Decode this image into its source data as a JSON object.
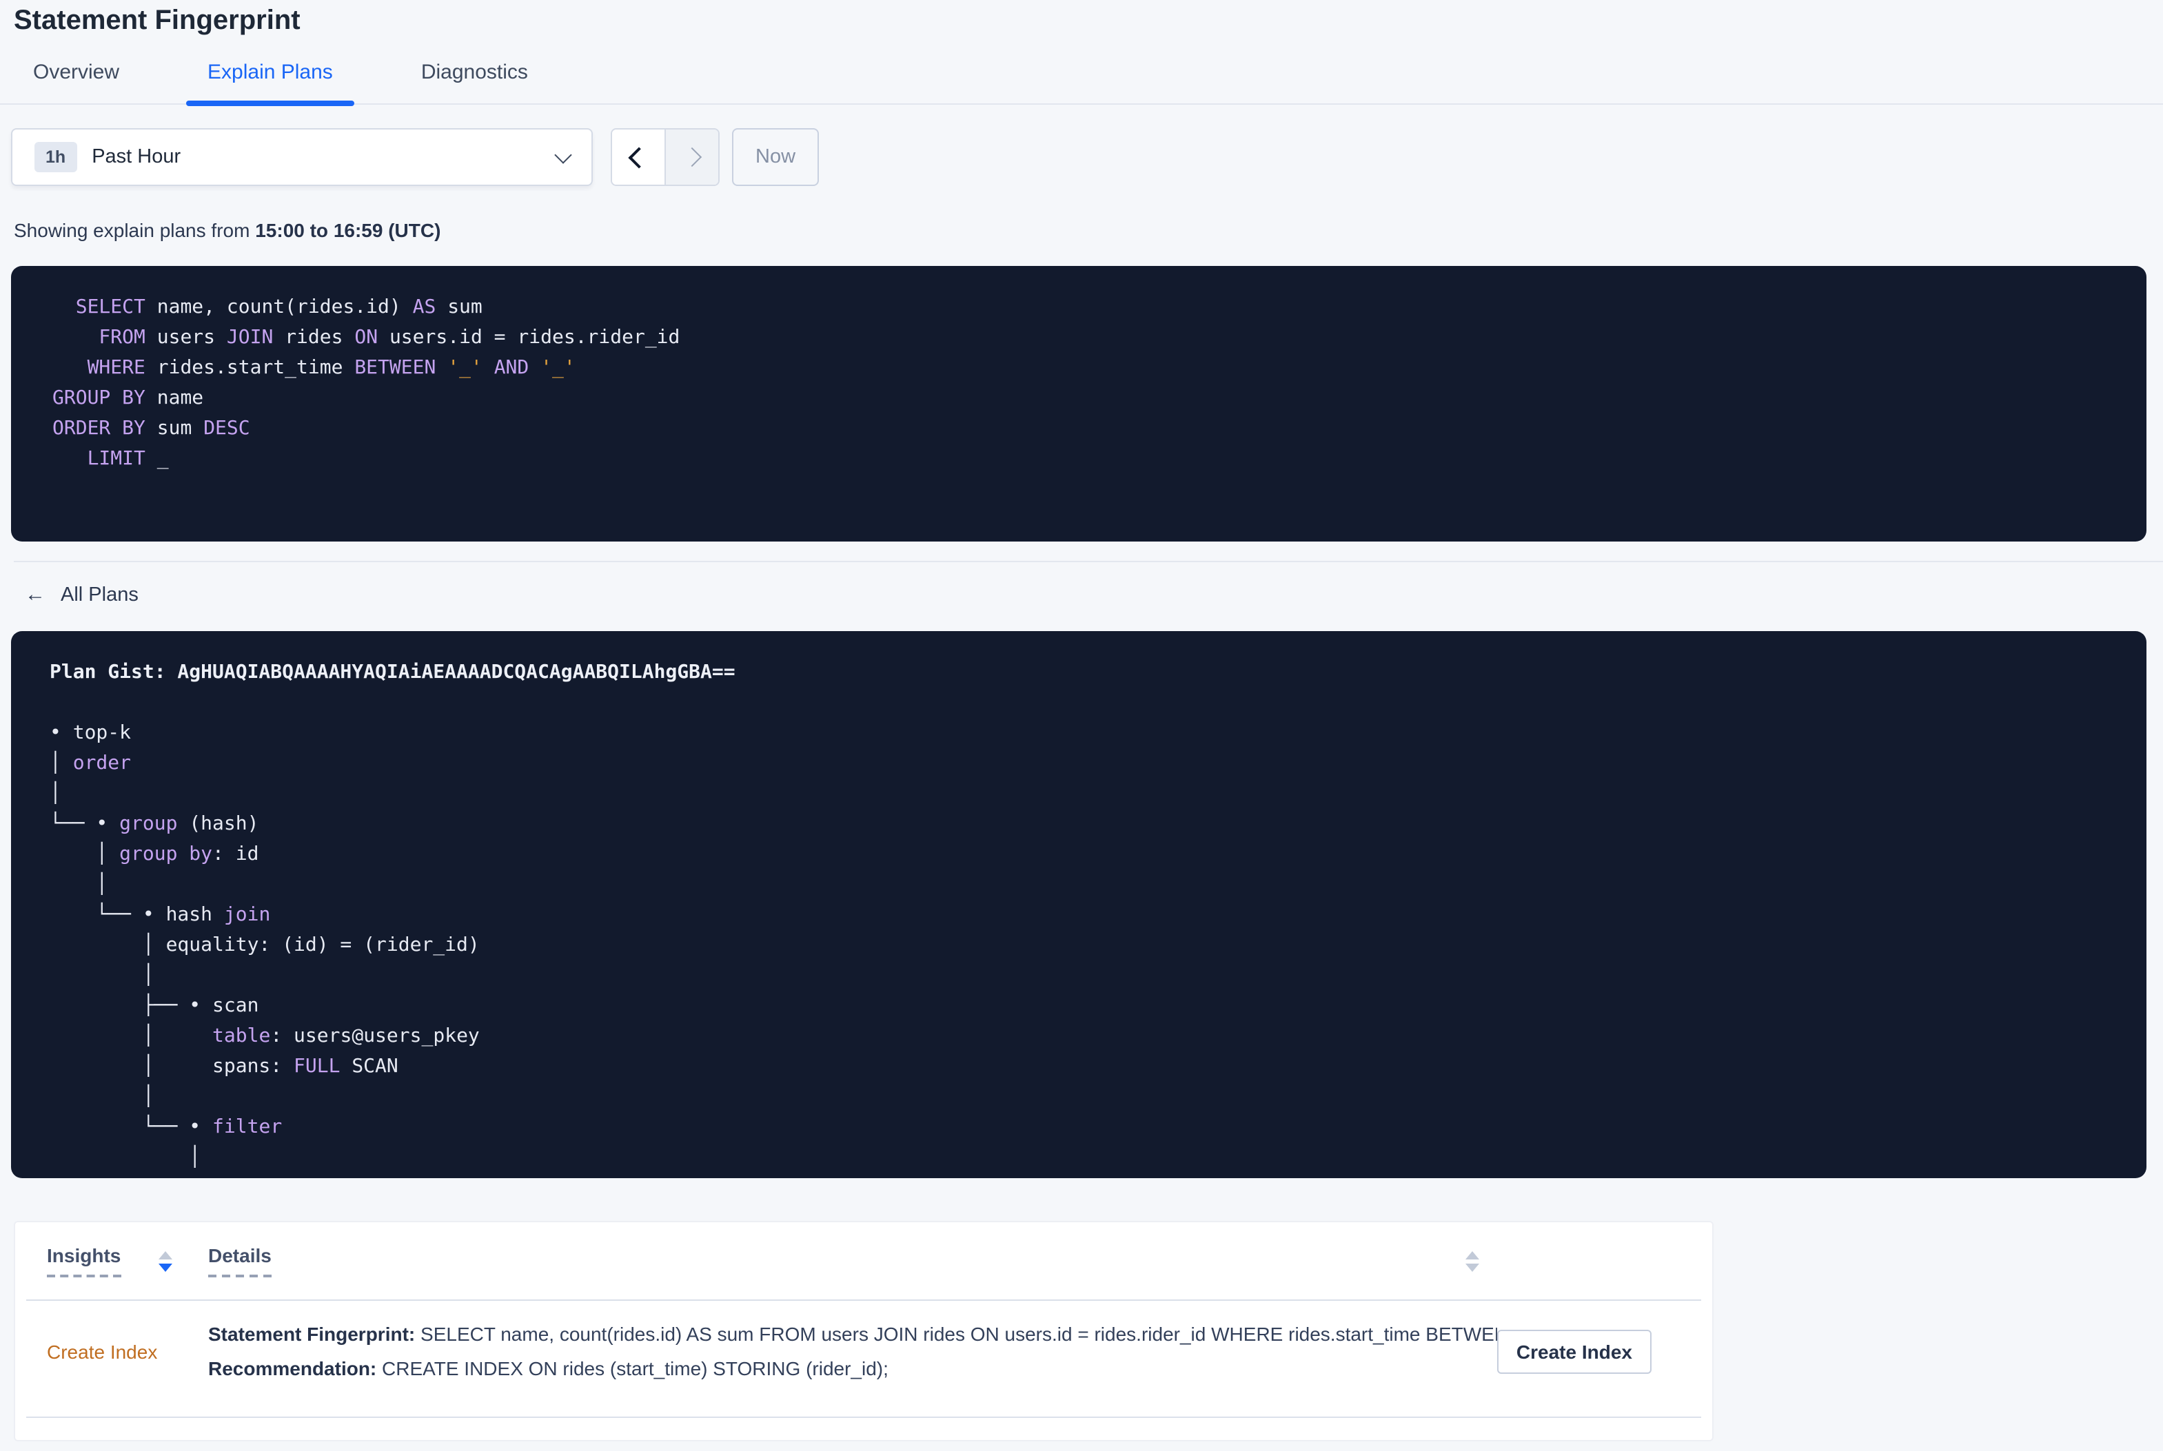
{
  "colors": {
    "accent_blue": "#1A66F6",
    "page_background": "#F5F7FA",
    "code_background": "#121A2D",
    "code_keyword_purple": "#C5A3F0",
    "code_literal_orange": "#E2A13D",
    "code_text": "#E7EAF3",
    "insight_link_orange": "#C06E21"
  },
  "header": {
    "title": "Statement Fingerprint"
  },
  "tabs": [
    {
      "label": "Overview",
      "active": false
    },
    {
      "label": "Explain Plans",
      "active": true
    },
    {
      "label": "Diagnostics",
      "active": false
    }
  ],
  "toolbar": {
    "interval_badge": "1h",
    "interval_label": "Past Hour",
    "dropdown_icon": "chevron-down",
    "prev_icon": "chevron-left",
    "next_icon": "chevron-right",
    "now_label": "Now"
  },
  "status_line": {
    "prefix": "Showing explain plans from ",
    "range": "15:00 to 16:59 (UTC)"
  },
  "sql_block": {
    "lines": [
      [
        [
          "k",
          "  SELECT"
        ],
        [
          "t",
          " name, count(rides.id) "
        ],
        [
          "k",
          "AS"
        ],
        [
          "t",
          " sum"
        ]
      ],
      [
        [
          "k",
          "    FROM"
        ],
        [
          "t",
          " users "
        ],
        [
          "k",
          "JOIN"
        ],
        [
          "t",
          " rides "
        ],
        [
          "k",
          "ON"
        ],
        [
          "t",
          " users.id = rides.rider_id"
        ]
      ],
      [
        [
          "k",
          "   WHERE"
        ],
        [
          "t",
          " rides.start_time "
        ],
        [
          "k",
          "BETWEEN"
        ],
        [
          "t",
          " "
        ],
        [
          "o",
          "'_'"
        ],
        [
          "t",
          " "
        ],
        [
          "k",
          "AND"
        ],
        [
          "t",
          " "
        ],
        [
          "o",
          "'_'"
        ]
      ],
      [
        [
          "k",
          "GROUP BY"
        ],
        [
          "t",
          " name"
        ]
      ],
      [
        [
          "k",
          "ORDER BY"
        ],
        [
          "t",
          " sum "
        ],
        [
          "k",
          "DESC"
        ]
      ],
      [
        [
          "k",
          "   LIMIT"
        ],
        [
          "t",
          " _"
        ]
      ]
    ]
  },
  "plans_nav": {
    "back_icon": "arrow-left",
    "back_glyph": "←",
    "back_label": "All Plans"
  },
  "plan_block": {
    "lines": [
      [
        [
          "bt",
          "Plan Gist: AgHUAQIABQAAAAHYAQIAiAEAAAADCQACAgAABQILAhgGBA=="
        ]
      ],
      [],
      [
        [
          "t",
          "• top-k"
        ]
      ],
      [
        [
          "t",
          "│ "
        ],
        [
          "k",
          "order"
        ]
      ],
      [
        [
          "t",
          "│"
        ]
      ],
      [
        [
          "t",
          "└── • "
        ],
        [
          "k",
          "group"
        ],
        [
          "t",
          " (hash)"
        ]
      ],
      [
        [
          "t",
          "    │ "
        ],
        [
          "k",
          "group by"
        ],
        [
          "t",
          ": id"
        ]
      ],
      [
        [
          "t",
          "    │"
        ]
      ],
      [
        [
          "t",
          "    └── • hash "
        ],
        [
          "k",
          "join"
        ]
      ],
      [
        [
          "t",
          "        │ equality: (id) = (rider_id)"
        ]
      ],
      [
        [
          "t",
          "        │"
        ]
      ],
      [
        [
          "t",
          "        ├── • scan"
        ]
      ],
      [
        [
          "t",
          "        │     "
        ],
        [
          "k",
          "table"
        ],
        [
          "t",
          ": users@users_pkey"
        ]
      ],
      [
        [
          "t",
          "        │     spans: "
        ],
        [
          "k",
          "FULL"
        ],
        [
          "t",
          " SCAN"
        ]
      ],
      [
        [
          "t",
          "        │"
        ]
      ],
      [
        [
          "t",
          "        └── • "
        ],
        [
          "k",
          "filter"
        ]
      ],
      [
        [
          "t",
          "            │"
        ]
      ]
    ]
  },
  "insights_table": {
    "columns": [
      {
        "label": "Insights",
        "sort": "desc"
      },
      {
        "label": "Details",
        "sort": "none"
      }
    ],
    "row": {
      "insight_label": "Create Index",
      "details": [
        {
          "label": "Statement Fingerprint:",
          "text": " SELECT name, count(rides.id) AS sum FROM users JOIN rides ON users.id = rides.rider_id WHERE rides.start_time BETWEEN '_…"
        },
        {
          "label": "Recommendation:",
          "text": " CREATE INDEX ON rides (start_time) STORING (rider_id);"
        }
      ],
      "action_label": "Create Index"
    }
  }
}
